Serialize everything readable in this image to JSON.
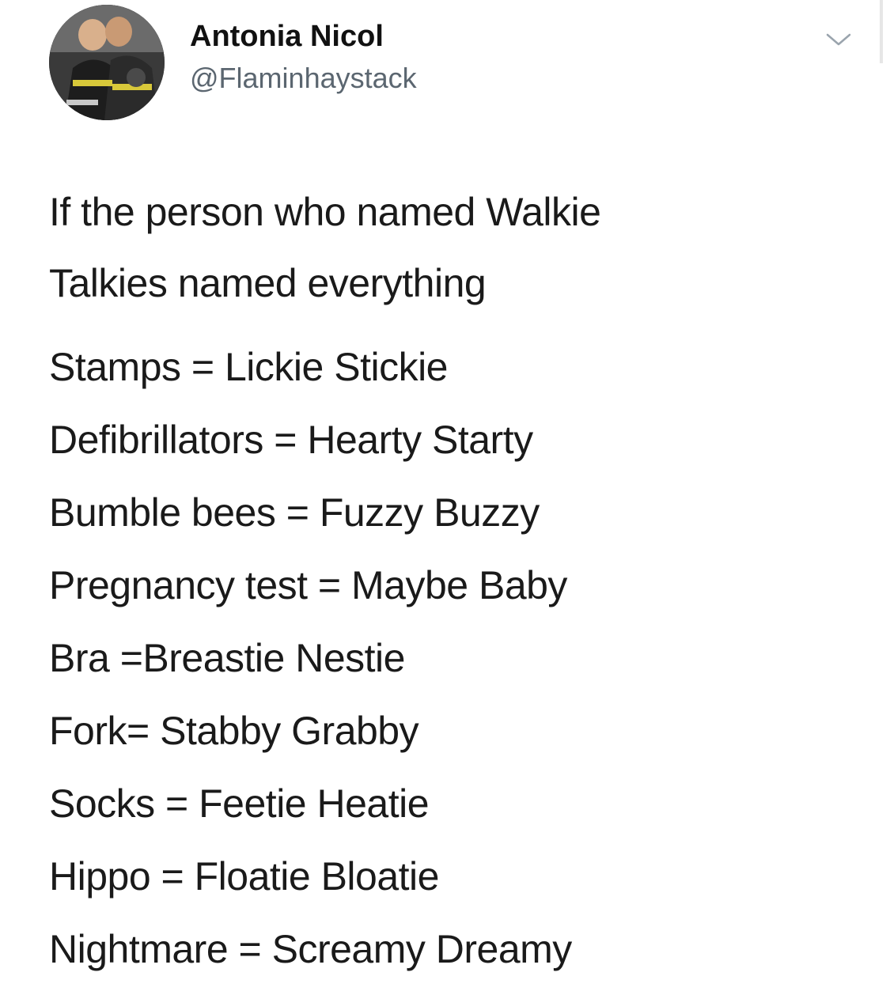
{
  "author": {
    "display_name": "Antonia Nicol",
    "handle": "@Flaminhaystack"
  },
  "tweet": {
    "intro_lines": [
      "If the person who named Walkie",
      "Talkies named everything"
    ],
    "pairs": [
      "Stamps = Lickie Stickie",
      "Defibrillators = Hearty Starty",
      "Bumble bees = Fuzzy Buzzy",
      "Pregnancy test = Maybe Baby",
      "Bra =Breastie Nestie",
      "Fork= Stabby Grabby",
      "Socks = Feetie Heatie",
      "Hippo = Floatie Bloatie",
      "Nightmare = Screamy Dreamy"
    ]
  },
  "icons": {
    "avatar": "profile-photo",
    "menu": "chevron-down-icon"
  },
  "colors": {
    "text": "#1a1a1a",
    "handle": "#5b6670",
    "caret": "#9aa4ad"
  }
}
